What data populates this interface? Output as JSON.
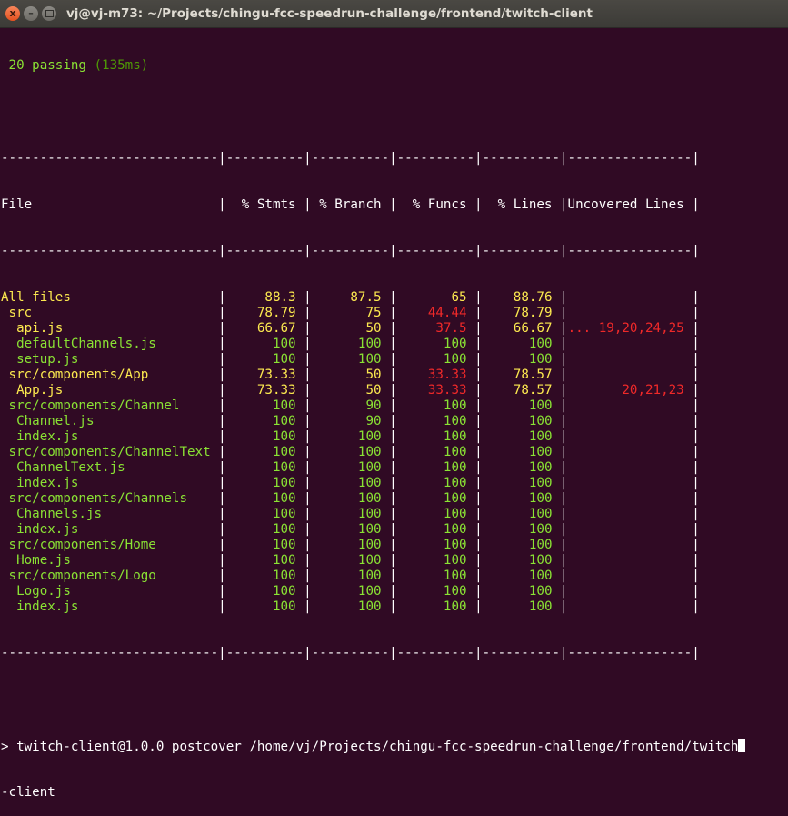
{
  "window": {
    "title": "vj@vj-m73: ~/Projects/chingu-fcc-speedrun-challenge/frontend/twitch-client",
    "close_label": "x",
    "minimize_label": "–"
  },
  "colors": {
    "background": "#300a24",
    "green": "#8ae234",
    "yellow": "#fce94f",
    "red": "#ef2929",
    "text": "#ffffff"
  },
  "terminal": {
    "passing": "20 passing",
    "passing_time": "(135ms)",
    "separator": "----------------------------|----------|----------|----------|----------|----------------|",
    "header": "File                        |  % Stmts | % Branch |  % Funcs |  % Lines |Uncovered Lines |",
    "row_all": "All files                   |",
    "rows": [
      {
        "file": "All files",
        "stmts": "88.3",
        "branch": "87.5",
        "funcs": "65",
        "lines": "88.76",
        "uncovered": ""
      },
      {
        "file": " src",
        "stmts": "78.79",
        "branch": "75",
        "funcs": "44.44",
        "lines": "78.79",
        "uncovered": ""
      },
      {
        "file": "  api.js",
        "stmts": "66.67",
        "branch": "50",
        "funcs": "37.5",
        "lines": "66.67",
        "uncovered": "... 19,20,24,25"
      },
      {
        "file": "  defaultChannels.js",
        "stmts": "100",
        "branch": "100",
        "funcs": "100",
        "lines": "100",
        "uncovered": ""
      },
      {
        "file": "  setup.js",
        "stmts": "100",
        "branch": "100",
        "funcs": "100",
        "lines": "100",
        "uncovered": ""
      },
      {
        "file": " src/components/App",
        "stmts": "73.33",
        "branch": "50",
        "funcs": "33.33",
        "lines": "78.57",
        "uncovered": ""
      },
      {
        "file": "  App.js",
        "stmts": "73.33",
        "branch": "50",
        "funcs": "33.33",
        "lines": "78.57",
        "uncovered": "20,21,23"
      },
      {
        "file": " src/components/Channel",
        "stmts": "100",
        "branch": "90",
        "funcs": "100",
        "lines": "100",
        "uncovered": ""
      },
      {
        "file": "  Channel.js",
        "stmts": "100",
        "branch": "90",
        "funcs": "100",
        "lines": "100",
        "uncovered": ""
      },
      {
        "file": "  index.js",
        "stmts": "100",
        "branch": "100",
        "funcs": "100",
        "lines": "100",
        "uncovered": ""
      },
      {
        "file": " src/components/ChannelText",
        "stmts": "100",
        "branch": "100",
        "funcs": "100",
        "lines": "100",
        "uncovered": ""
      },
      {
        "file": "  ChannelText.js",
        "stmts": "100",
        "branch": "100",
        "funcs": "100",
        "lines": "100",
        "uncovered": ""
      },
      {
        "file": "  index.js",
        "stmts": "100",
        "branch": "100",
        "funcs": "100",
        "lines": "100",
        "uncovered": ""
      },
      {
        "file": " src/components/Channels",
        "stmts": "100",
        "branch": "100",
        "funcs": "100",
        "lines": "100",
        "uncovered": ""
      },
      {
        "file": "  Channels.js",
        "stmts": "100",
        "branch": "100",
        "funcs": "100",
        "lines": "100",
        "uncovered": ""
      },
      {
        "file": "  index.js",
        "stmts": "100",
        "branch": "100",
        "funcs": "100",
        "lines": "100",
        "uncovered": ""
      },
      {
        "file": " src/components/Home",
        "stmts": "100",
        "branch": "100",
        "funcs": "100",
        "lines": "100",
        "uncovered": ""
      },
      {
        "file": "  Home.js",
        "stmts": "100",
        "branch": "100",
        "funcs": "100",
        "lines": "100",
        "uncovered": ""
      },
      {
        "file": " src/components/Logo",
        "stmts": "100",
        "branch": "100",
        "funcs": "100",
        "lines": "100",
        "uncovered": ""
      },
      {
        "file": "  Logo.js",
        "stmts": "100",
        "branch": "100",
        "funcs": "100",
        "lines": "100",
        "uncovered": ""
      },
      {
        "file": "  index.js",
        "stmts": "100",
        "branch": "100",
        "funcs": "100",
        "lines": "100",
        "uncovered": ""
      }
    ],
    "row_colors": [
      [
        "y",
        "y",
        "y",
        "y",
        "y"
      ],
      [
        "y",
        "y",
        "r",
        "y",
        "w"
      ],
      [
        "y",
        "y",
        "r",
        "y",
        "r"
      ],
      [
        "g",
        "g",
        "g",
        "g",
        "w"
      ],
      [
        "g",
        "g",
        "g",
        "g",
        "w"
      ],
      [
        "y",
        "y",
        "r",
        "y",
        "w"
      ],
      [
        "y",
        "y",
        "r",
        "y",
        "r"
      ],
      [
        "g",
        "g",
        "g",
        "g",
        "w"
      ],
      [
        "g",
        "g",
        "g",
        "g",
        "w"
      ],
      [
        "g",
        "g",
        "g",
        "g",
        "w"
      ],
      [
        "g",
        "g",
        "g",
        "g",
        "w"
      ],
      [
        "g",
        "g",
        "g",
        "g",
        "w"
      ],
      [
        "g",
        "g",
        "g",
        "g",
        "w"
      ],
      [
        "g",
        "g",
        "g",
        "g",
        "w"
      ],
      [
        "g",
        "g",
        "g",
        "g",
        "w"
      ],
      [
        "g",
        "g",
        "g",
        "g",
        "w"
      ],
      [
        "g",
        "g",
        "g",
        "g",
        "w"
      ],
      [
        "g",
        "g",
        "g",
        "g",
        "w"
      ],
      [
        "g",
        "g",
        "g",
        "g",
        "w"
      ],
      [
        "g",
        "g",
        "g",
        "g",
        "w"
      ],
      [
        "g",
        "g",
        "g",
        "g",
        "w"
      ]
    ],
    "prompt_line1": "> twitch-client@1.0.0 postcover /home/vj/Projects/chingu-fcc-speedrun-challenge/frontend/twitch",
    "prompt_line2": "-client"
  }
}
